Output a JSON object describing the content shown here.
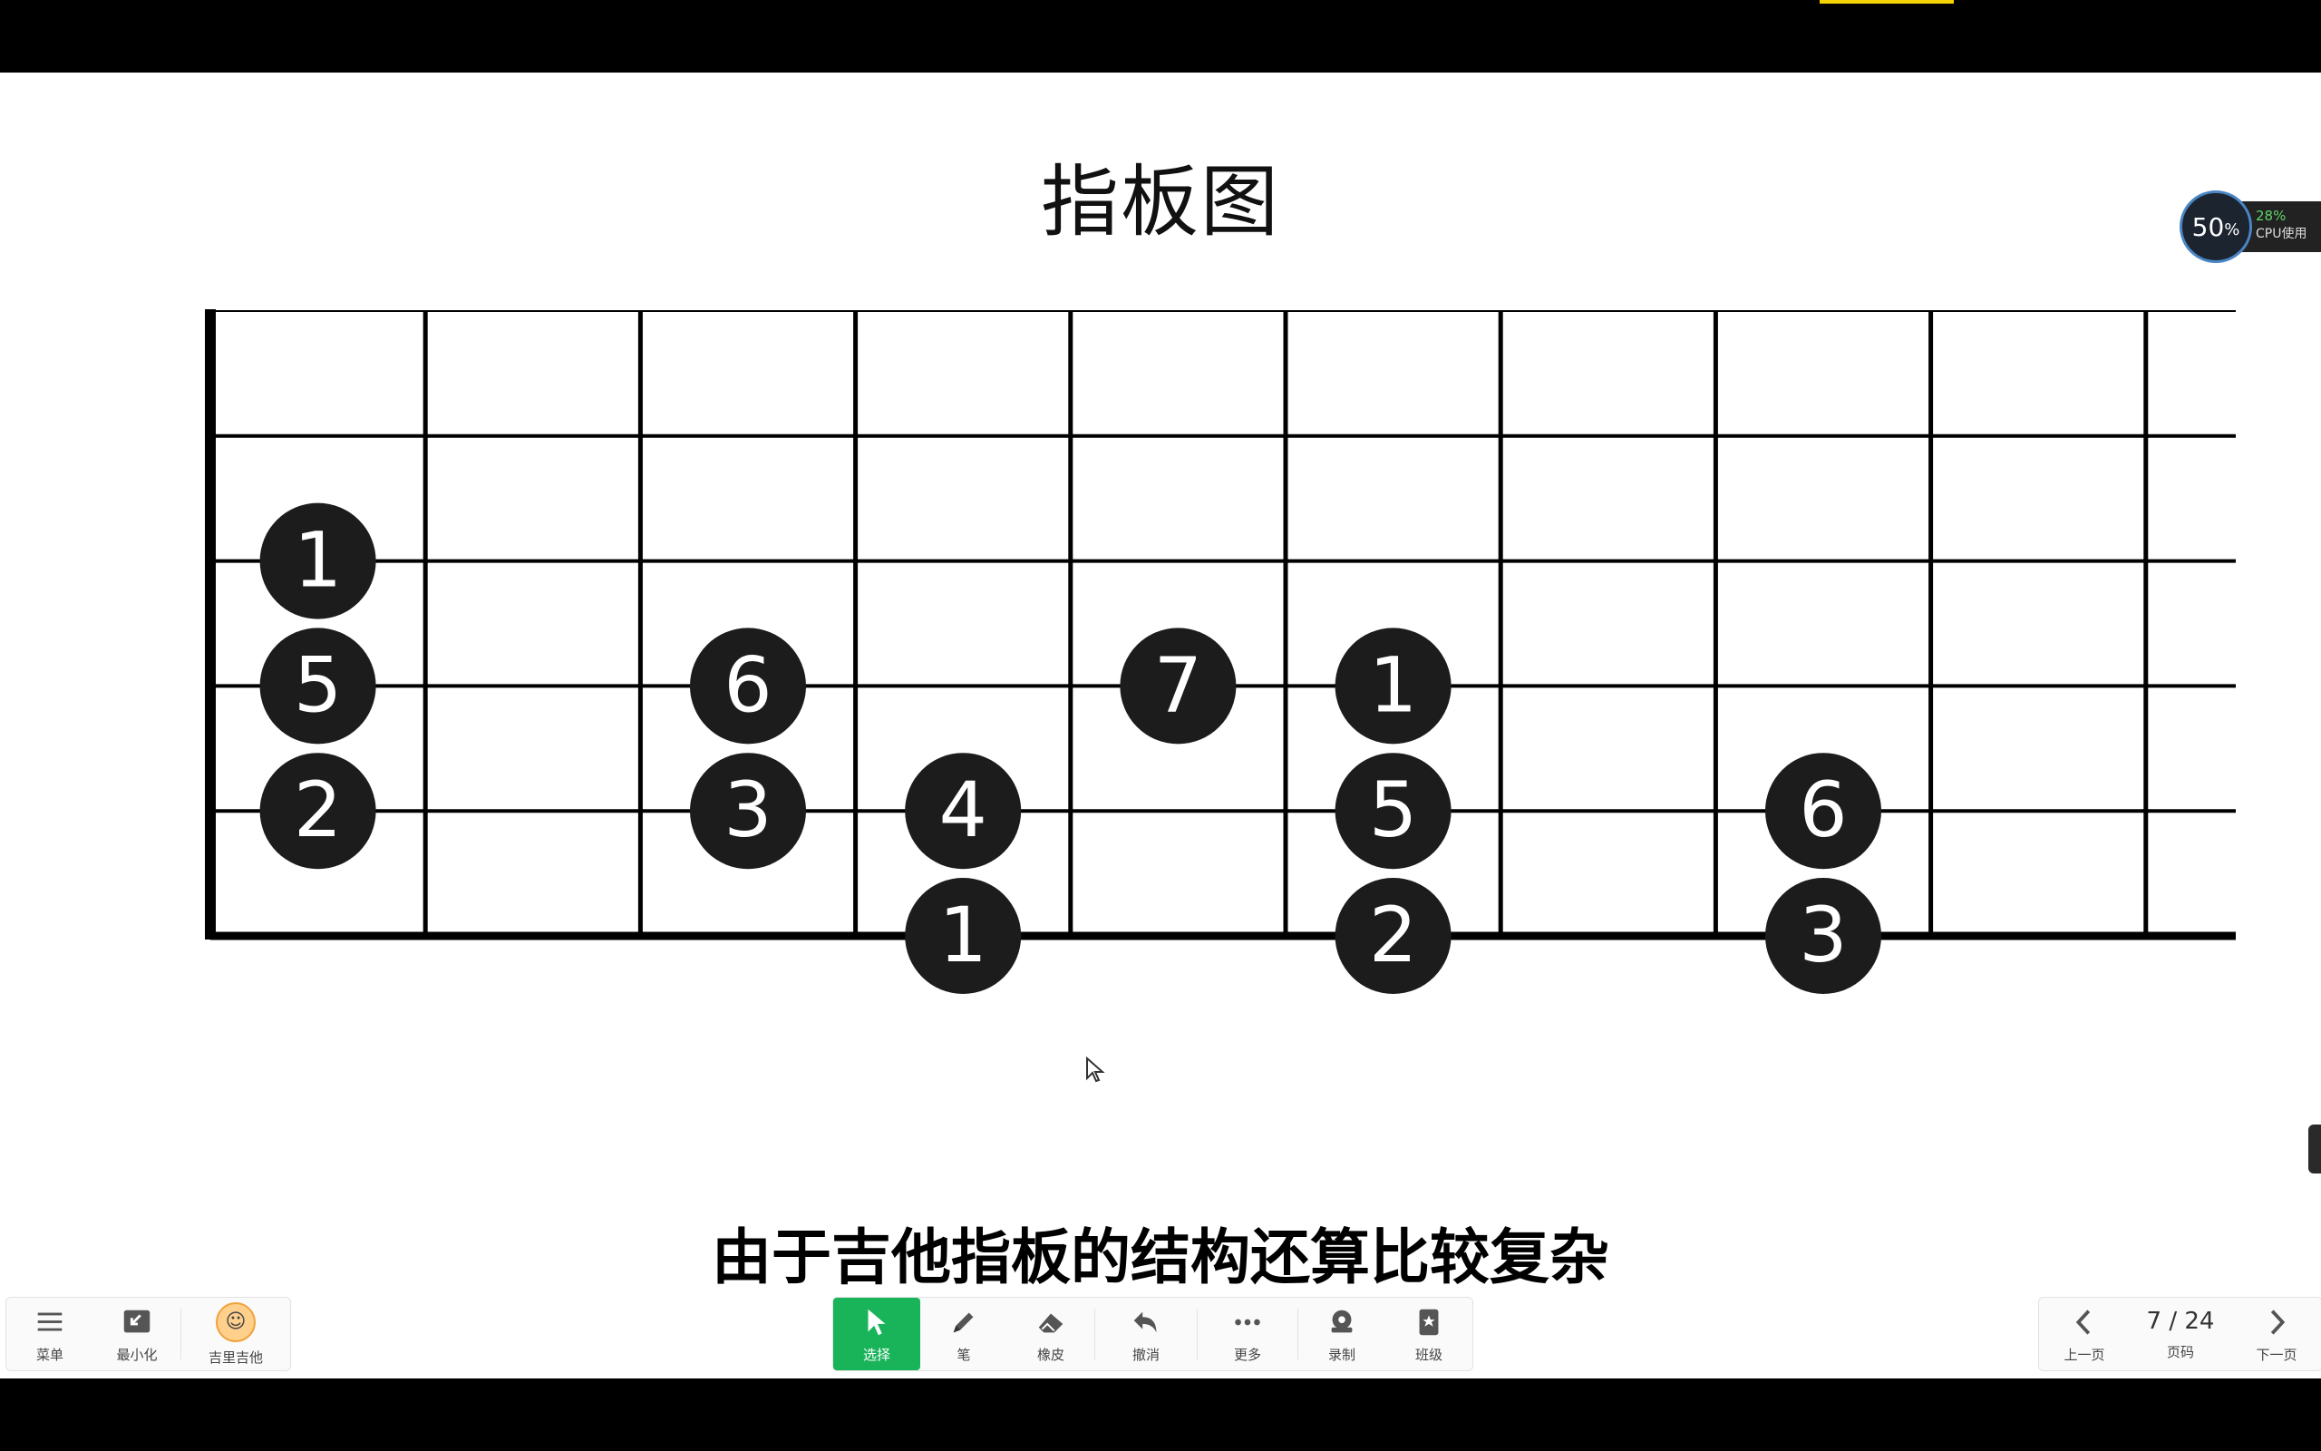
{
  "slide": {
    "title": "指板图",
    "subtitle": "由于吉他指板的结构还算比较复杂"
  },
  "fretboard": {
    "notes": [
      {
        "fret": 1,
        "string": 3,
        "label": "1"
      },
      {
        "fret": 1,
        "string": 4,
        "label": "5"
      },
      {
        "fret": 1,
        "string": 5,
        "label": "2"
      },
      {
        "fret": 3,
        "string": 4,
        "label": "6"
      },
      {
        "fret": 3,
        "string": 5,
        "label": "3"
      },
      {
        "fret": 4,
        "string": 5,
        "label": "4"
      },
      {
        "fret": 4,
        "string": 6,
        "label": "1"
      },
      {
        "fret": 5,
        "string": 4,
        "label": "7"
      },
      {
        "fret": 6,
        "string": 4,
        "label": "1"
      },
      {
        "fret": 6,
        "string": 5,
        "label": "5"
      },
      {
        "fret": 6,
        "string": 6,
        "label": "2"
      },
      {
        "fret": 8,
        "string": 5,
        "label": "6"
      },
      {
        "fret": 8,
        "string": 6,
        "label": "3"
      }
    ]
  },
  "cpu": {
    "main": "50",
    "main_unit": "%",
    "secondary": "28%",
    "label": "CPU使用"
  },
  "toolbar": {
    "menu_label": "菜单",
    "minimize_label": "最小化",
    "profile_label": "吉里吉他",
    "select_label": "选择",
    "pen_label": "笔",
    "eraser_label": "橡皮",
    "undo_label": "撤消",
    "more_label": "更多",
    "record_label": "录制",
    "class_label": "班级",
    "prev_label": "上一页",
    "page_label": "页码",
    "next_label": "下一页",
    "page_indicator": "7 / 24"
  },
  "colors": {
    "accent": "#19b35a",
    "top_accent": "#f5d300",
    "note_fill": "#1c1c1c"
  }
}
